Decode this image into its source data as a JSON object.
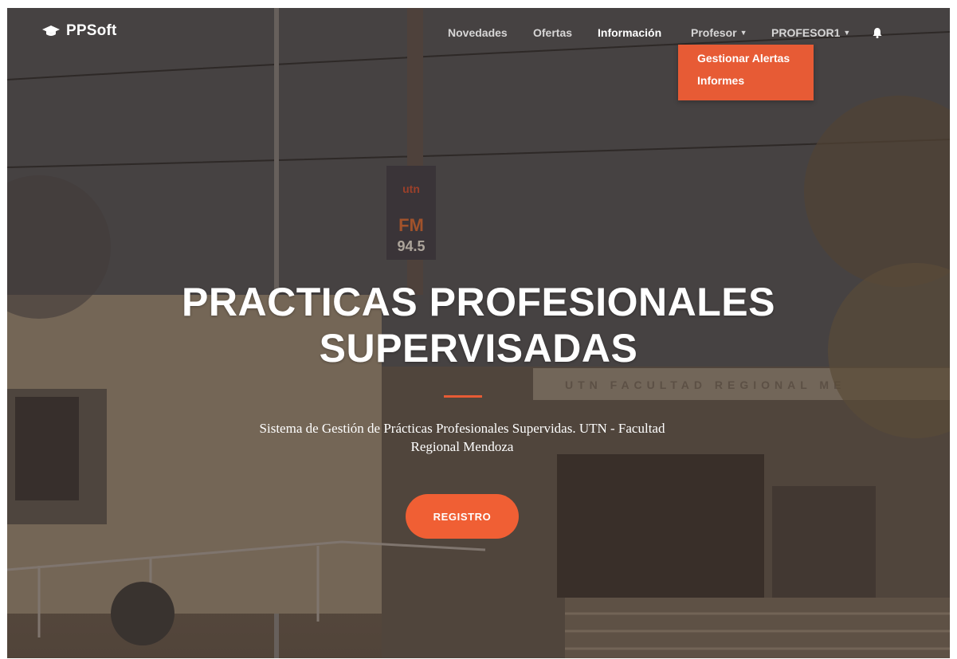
{
  "nav": {
    "brand": "PPSoft",
    "links": [
      {
        "label": "Novedades"
      },
      {
        "label": "Ofertas"
      },
      {
        "label": "Información"
      },
      {
        "label": "Profesor"
      },
      {
        "label": "PROFESOR1"
      }
    ],
    "dropdown": [
      "Gestionar Alertas",
      "Informes"
    ]
  },
  "hero": {
    "title_line1": "PRACTICAS PROFESIONALES",
    "title_line2": "SUPERVISADAS",
    "subtitle_line1": "Sistema de Gestión de Prácticas Profesionales Supervidas. UTN - Facultad",
    "subtitle_line2": "Regional Mendoza",
    "button": "REGISTRO"
  },
  "background_sign": {
    "tower": [
      "utn",
      "FM",
      "94.5"
    ],
    "building": "UTN FACULTAD REGIONAL ME"
  },
  "colors": {
    "accent": "#e75b35",
    "button": "#f05f34",
    "text": "#ffffff"
  }
}
